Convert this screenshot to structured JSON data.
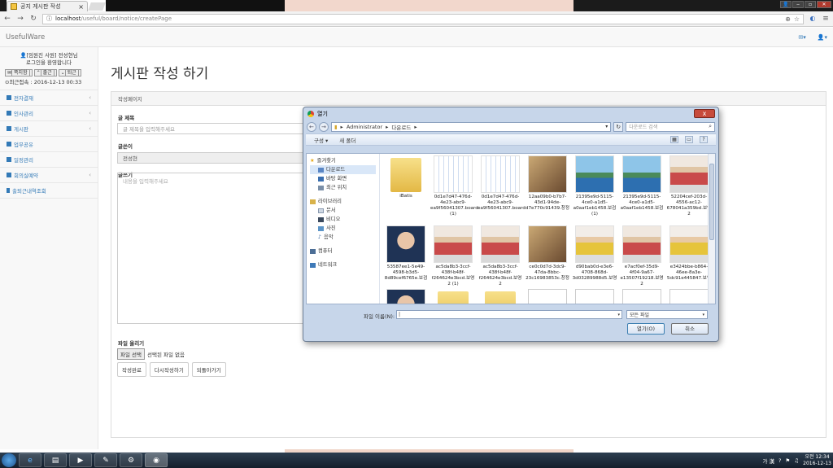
{
  "browser": {
    "tab_title": "공지 게시판 작성",
    "tab_close": "×",
    "url_host": "localhost",
    "url_path": "/useful/board/notice/createPage"
  },
  "navbar": {
    "brand": "UsefulWare",
    "mail_icon": "▾",
    "user_icon": "▾"
  },
  "sidebar": {
    "user_line1": "[임원진 사원] 전성현님",
    "user_line2": "로그인을 환영합니다",
    "btn_notes": "쪽지함",
    "btn_in": "출근",
    "btn_out": "퇴근",
    "last_login": "최근접속 : 2016-12-13 00:33",
    "items": [
      {
        "label": "전자결재",
        "chev": "‹"
      },
      {
        "label": "인사관리",
        "chev": "‹"
      },
      {
        "label": "게시판",
        "chev": "‹"
      },
      {
        "label": "업무공유",
        "chev": ""
      },
      {
        "label": "일정관리",
        "chev": ""
      },
      {
        "label": "회의실예약",
        "chev": "‹"
      },
      {
        "label": "출퇴근내역조회",
        "chev": ""
      }
    ]
  },
  "main": {
    "page_title": "게시판 작성 하기",
    "panel_head": "작성페이지",
    "title_label": "글 제목",
    "title_placeholder": "글 제목을 입력해주세요",
    "author_label": "글쓴이",
    "author_value": "전성현",
    "content_label": "글쓰기",
    "content_placeholder": "내용을 입력해주세요",
    "upload_label": "파일 올리기",
    "file_btn": "파일 선택",
    "file_status": "선택된 파일 없음",
    "btn_submit": "작성완료",
    "btn_rewrite": "다시작성하기",
    "btn_back": "되돌아가기"
  },
  "dialog": {
    "title": "열기",
    "close": "x",
    "crumb_1": "Administrator",
    "crumb_2": "다운로드",
    "search_placeholder": "다운로드 검색",
    "tool_org": "구성 ▾",
    "tool_newfolder": "새 폴더",
    "tree": {
      "favorites": "즐겨찾기",
      "downloads": "다운로드",
      "desktop": "바탕 화면",
      "recent": "최근 위치",
      "libraries": "라이브러리",
      "docs": "문서",
      "video": "비디오",
      "pictures": "사진",
      "music": "음악",
      "computer": "컴퓨터",
      "network": "네트워크"
    },
    "files": [
      {
        "name": "iBatis",
        "kind": "folder"
      },
      {
        "name": "0d1e7d47-476d-4e23-abc9-ea9f56041307.board (1)",
        "kind": "diagram"
      },
      {
        "name": "0d1e7d47-476d-4e23-abc9-ea9f56041307.board",
        "kind": "diagram"
      },
      {
        "name": "12aa09b0-b7b7-43d1-94de-d7e770c91439.창정",
        "kind": "poster"
      },
      {
        "name": "21395e9d-5115-4ce0-a1d5-a0aaf1eb1458.보검 (1)",
        "kind": "mount"
      },
      {
        "name": "21395e9d-5115-4ce0-a1d5-a0aaf1eb1458.보검",
        "kind": "mount"
      },
      {
        "name": "52204cef-203d-4556-ac12-678041a359bd.보영2",
        "kind": "person"
      },
      {
        "name": "53587ee1-5e49-4598-b3d5-8d89cef6765e.보검",
        "kind": "face"
      },
      {
        "name": "ac5da8b3-3ccf-438f-b48f-f264624e3bcd.보영2 (1)",
        "kind": "person"
      },
      {
        "name": "ac5da8b3-3ccf-438f-b48f-f264624e3bcd.보영2",
        "kind": "person"
      },
      {
        "name": "ce0c0d7d-3dc9-47da-8bbc-23c16983853c.창정",
        "kind": "poster"
      },
      {
        "name": "d90bab0d-e3e6-4708-868d-3d03289988d5.보영",
        "kind": "yellow"
      },
      {
        "name": "e7acf0ef-35d9-4f04-9a67-e13507f19218.보영2",
        "kind": "person"
      },
      {
        "name": "e3424bbe-b864-46ee-8a3e-5dc91e445847.보영",
        "kind": "yellow"
      }
    ],
    "filename_label": "파일 이름(N):",
    "filename_value": "",
    "filetype": "모든 파일",
    "btn_open": "열기(O)",
    "btn_cancel": "취소"
  },
  "taskbar": {
    "ime": "가 漢",
    "time": "오전 12:34",
    "date": "2016-12-13"
  }
}
